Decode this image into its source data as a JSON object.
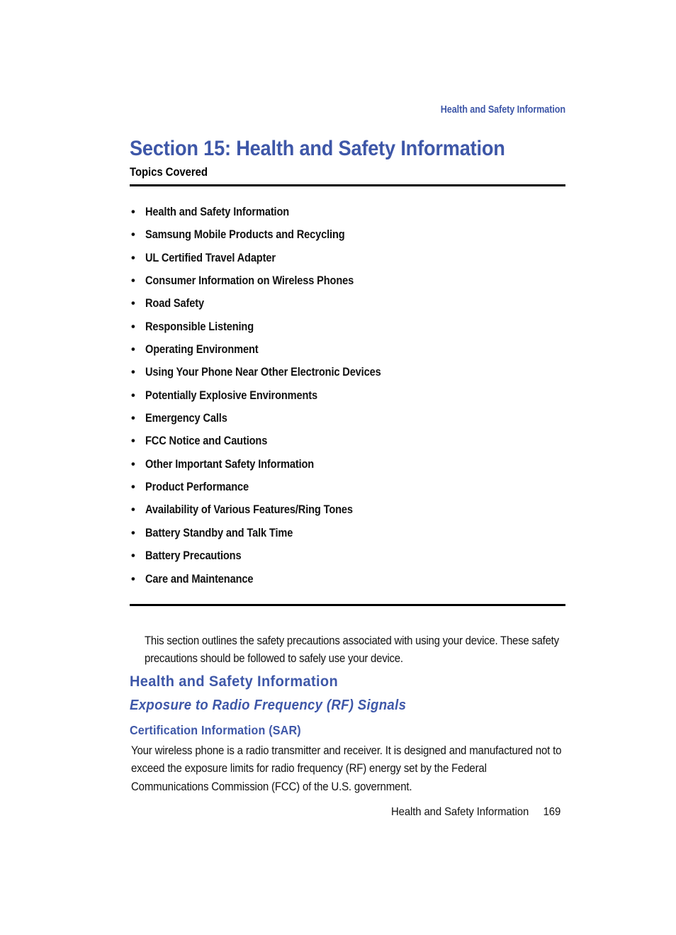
{
  "document": {
    "running_header": "Health and Safety Information",
    "section_title": "Section 15: Health and Safety Information",
    "topics_label": "Topics Covered",
    "accent_color": "#3E57A8",
    "text_color": "#111111",
    "bullet_glyph": "•"
  },
  "topics": [
    {
      "label": "Health and Safety Information"
    },
    {
      "label": "Samsung Mobile Products and Recycling"
    },
    {
      "label": "UL Certified Travel Adapter"
    },
    {
      "label": "Consumer Information on Wireless Phones"
    },
    {
      "label": "Road Safety"
    },
    {
      "label": "Responsible Listening"
    },
    {
      "label": "Operating Environment"
    },
    {
      "label": "Using Your Phone Near Other Electronic Devices"
    },
    {
      "label": "Potentially Explosive Environments"
    },
    {
      "label": "Emergency Calls"
    },
    {
      "label": "FCC Notice and Cautions"
    },
    {
      "label": "Other Important Safety Information"
    },
    {
      "label": "Product Performance"
    },
    {
      "label": "Availability of Various Features/Ring Tones"
    },
    {
      "label": "Battery Standby and Talk Time"
    },
    {
      "label": "Battery Precautions"
    },
    {
      "label": "Care and Maintenance"
    }
  ],
  "content": {
    "intro_paragraph": "This section outlines the safety precautions associated with using your device. These safety precautions should be followed to safely use your device.",
    "heading_1": "Health and Safety Information",
    "heading_2": "Exposure to Radio Frequency (RF) Signals",
    "heading_3": "Certification Information (SAR)",
    "body_paragraph": "Your wireless phone is a radio transmitter and receiver. It is designed and manufactured not to exceed the exposure limits for radio frequency (RF) energy set by the Federal Communications Commission (FCC) of the U.S. government."
  },
  "footer": {
    "label": "Health and Safety Information",
    "page_number": "169"
  }
}
